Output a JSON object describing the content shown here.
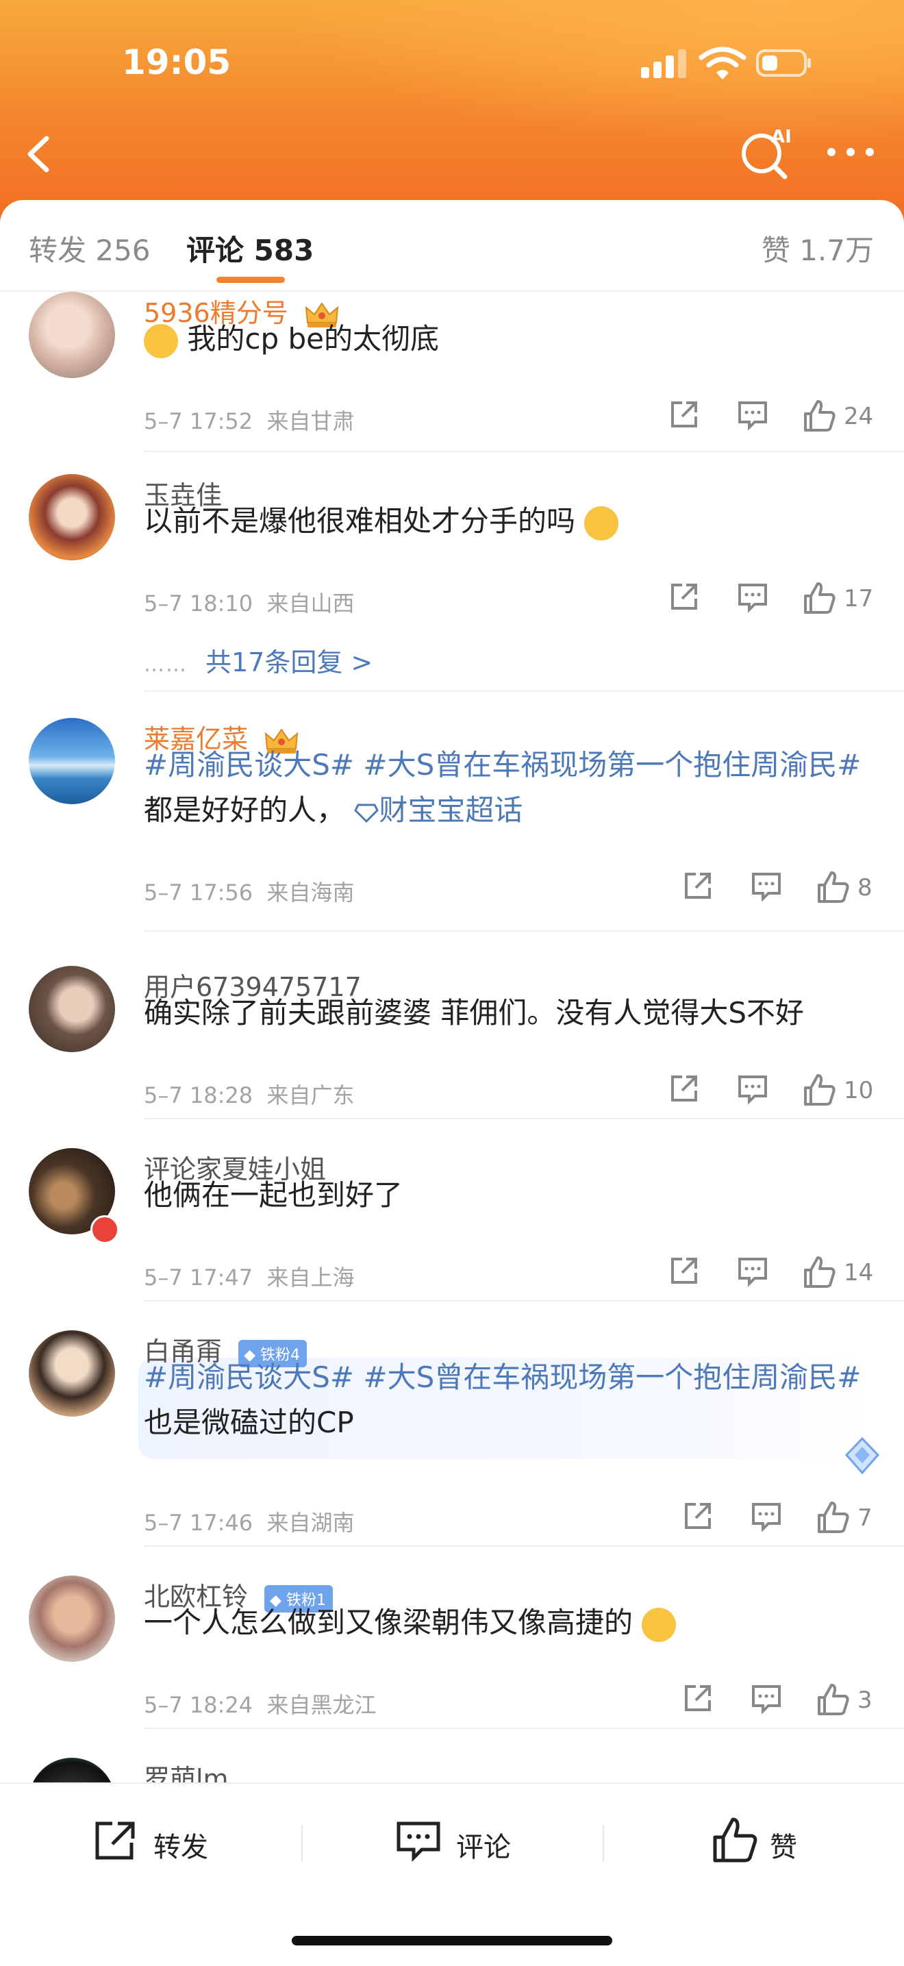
{
  "status": {
    "time": "19:05"
  },
  "header": {
    "back_icon": "chevron-left-icon",
    "ai_icon": "ai-search-icon",
    "more_icon": "more-horizontal-icon"
  },
  "tabs": {
    "repost": "转发 256",
    "comments": "评论 583",
    "likes": "赞 1.7万",
    "accent": "#f5842e"
  },
  "comments": [
    {
      "user": "5936精分号",
      "text": "我的cp be的太彻底",
      "time": "5–7 17:52",
      "loc": "来自甘肃",
      "likes": "24"
    },
    {
      "user": "玉垚佳",
      "text": "以前不是爆他很难相处才分手的吗",
      "time": "5–7 18:10",
      "loc": "来自山西",
      "likes": "17",
      "replies": "共17条回复 >",
      "reply_dots": "……"
    },
    {
      "user": "莱嘉亿菜",
      "hashtag1": "#周渝民谈大S#",
      "hashtag2": "#大S曾在车祸现场第一个抱住周渝民#",
      "text": "都是好好的人，",
      "super_topic": "财宝宝超话",
      "time": "5–7 17:56",
      "loc": "来自海南",
      "likes": "8"
    },
    {
      "user": "用户6739475717",
      "text": "确实除了前夫跟前婆婆 菲佣们。没有人觉得大S不好",
      "time": "5–7 18:28",
      "loc": "来自广东",
      "likes": "10"
    },
    {
      "user": "评论家夏娃小姐",
      "text": "他俩在一起也到好了",
      "time": "5–7 17:47",
      "loc": "来自上海",
      "likes": "14"
    },
    {
      "user": "白甬甭",
      "badge": "铁粉4",
      "hashtag1": "#周渝民谈大S#",
      "hashtag2": "#大S曾在车祸现场第一个抱住周渝民#",
      "text": "也是微磕过的CP",
      "time": "5–7 17:46",
      "loc": "来自湖南",
      "likes": "7"
    },
    {
      "user": "北欧杠铃",
      "badge": "铁粉1",
      "text": "一个人怎么做到又像梁朝伟又像高捷的",
      "time": "5–7 18:24",
      "loc": "来自黑龙江",
      "likes": "3"
    },
    {
      "user": "罗萌lm"
    }
  ],
  "bottom": {
    "repost": "转发",
    "comment": "评论",
    "like": "赞"
  }
}
